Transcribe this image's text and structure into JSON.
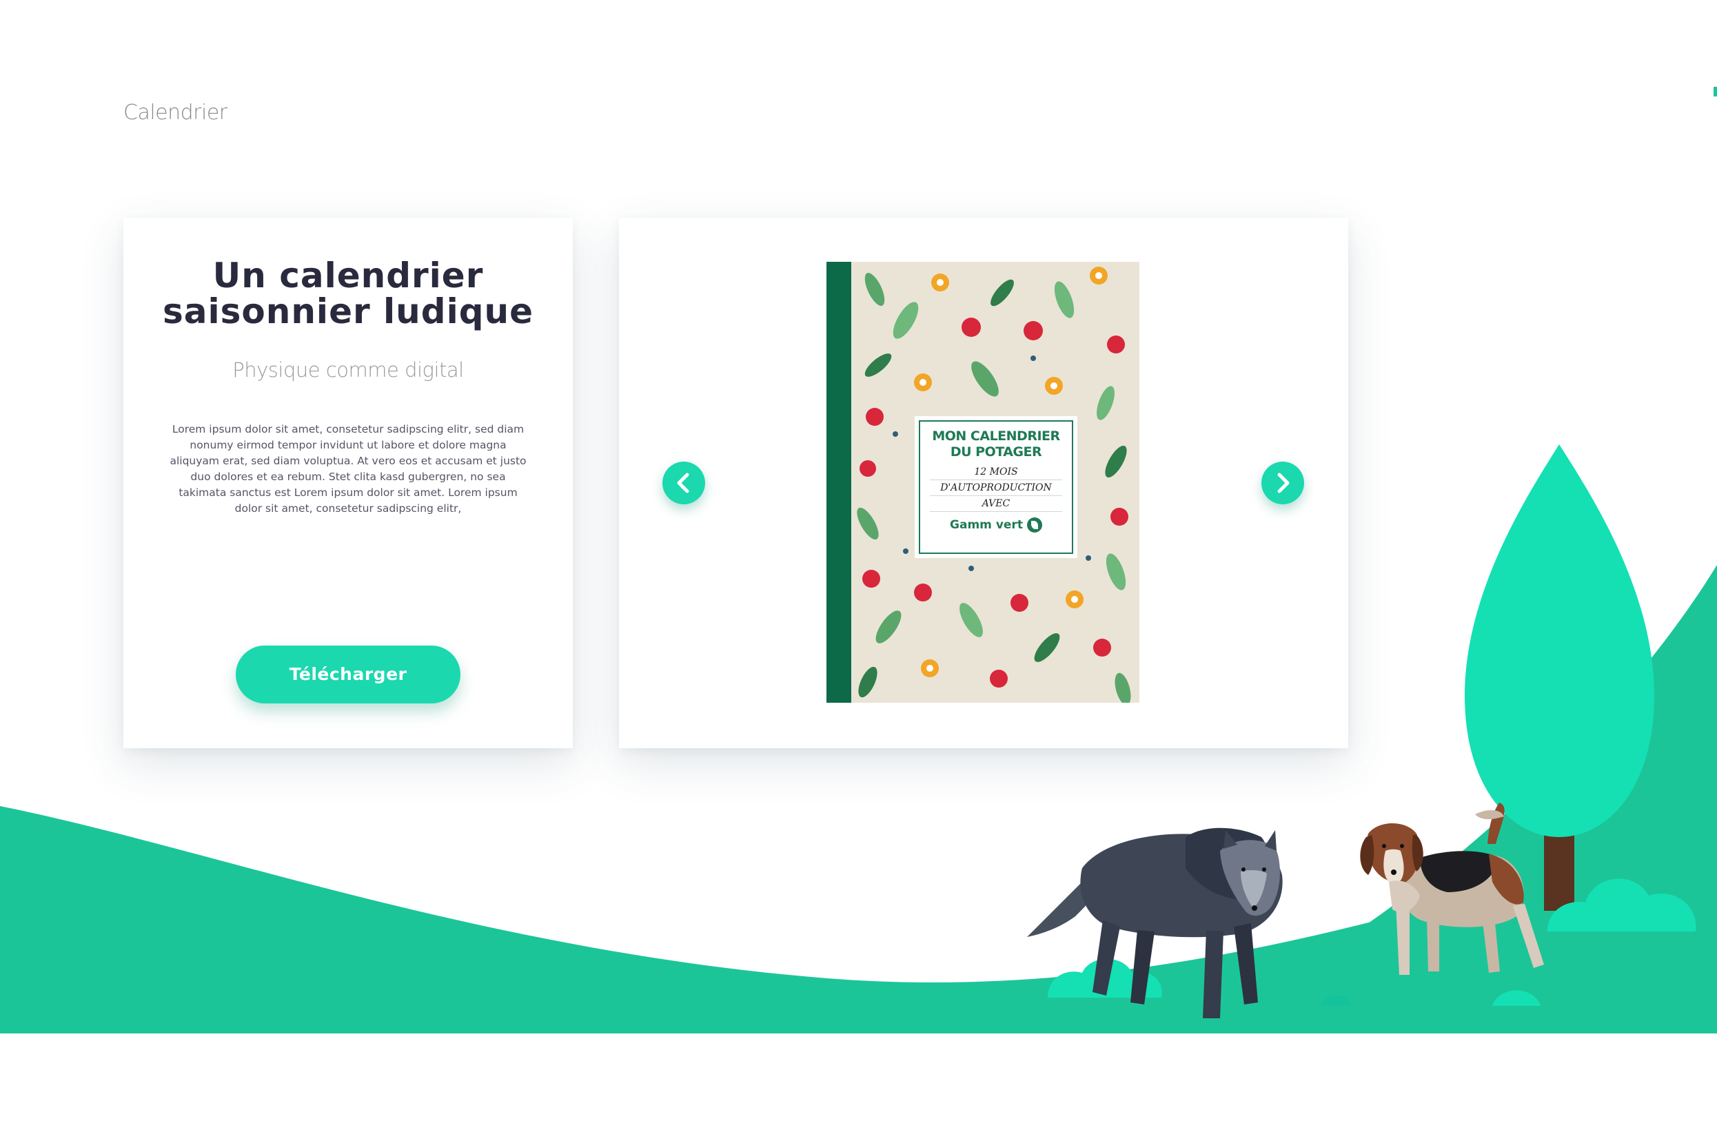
{
  "breadcrumb": {
    "label": "Calendrier"
  },
  "info_card": {
    "title": "Un calendrier saisonnier ludique",
    "subtitle": "Physique comme digital",
    "body": "Lorem ipsum dolor sit amet, consetetur sadipscing elitr, sed diam nonumy eirmod tempor invidunt ut labore et dolore magna aliquyam erat, sed diam voluptua. At vero eos et accusam et justo duo dolores et ea rebum. Stet clita kasd gubergren, no sea takimata sanctus est Lorem ipsum dolor sit amet. Lorem ipsum dolor sit amet, consetetur sadipscing elitr,",
    "download_label": "Télécharger"
  },
  "carousel": {
    "prev_icon": "chevron-left-icon",
    "next_icon": "chevron-right-icon",
    "book": {
      "title_line1": "MON CALENDRIER",
      "title_line2": "DU POTAGER",
      "sub_line1": "12 MOIS",
      "sub_line2": "D'AUTOPRODUCTION",
      "sub_line3": "AVEC",
      "brand": "Gamm vert"
    }
  },
  "colors": {
    "accent": "#1bd8ae",
    "landscape_green": "#1cc598",
    "tree_green": "#14e0b4",
    "title_dark": "#2a2a3e",
    "book_green": "#1e7a55"
  }
}
